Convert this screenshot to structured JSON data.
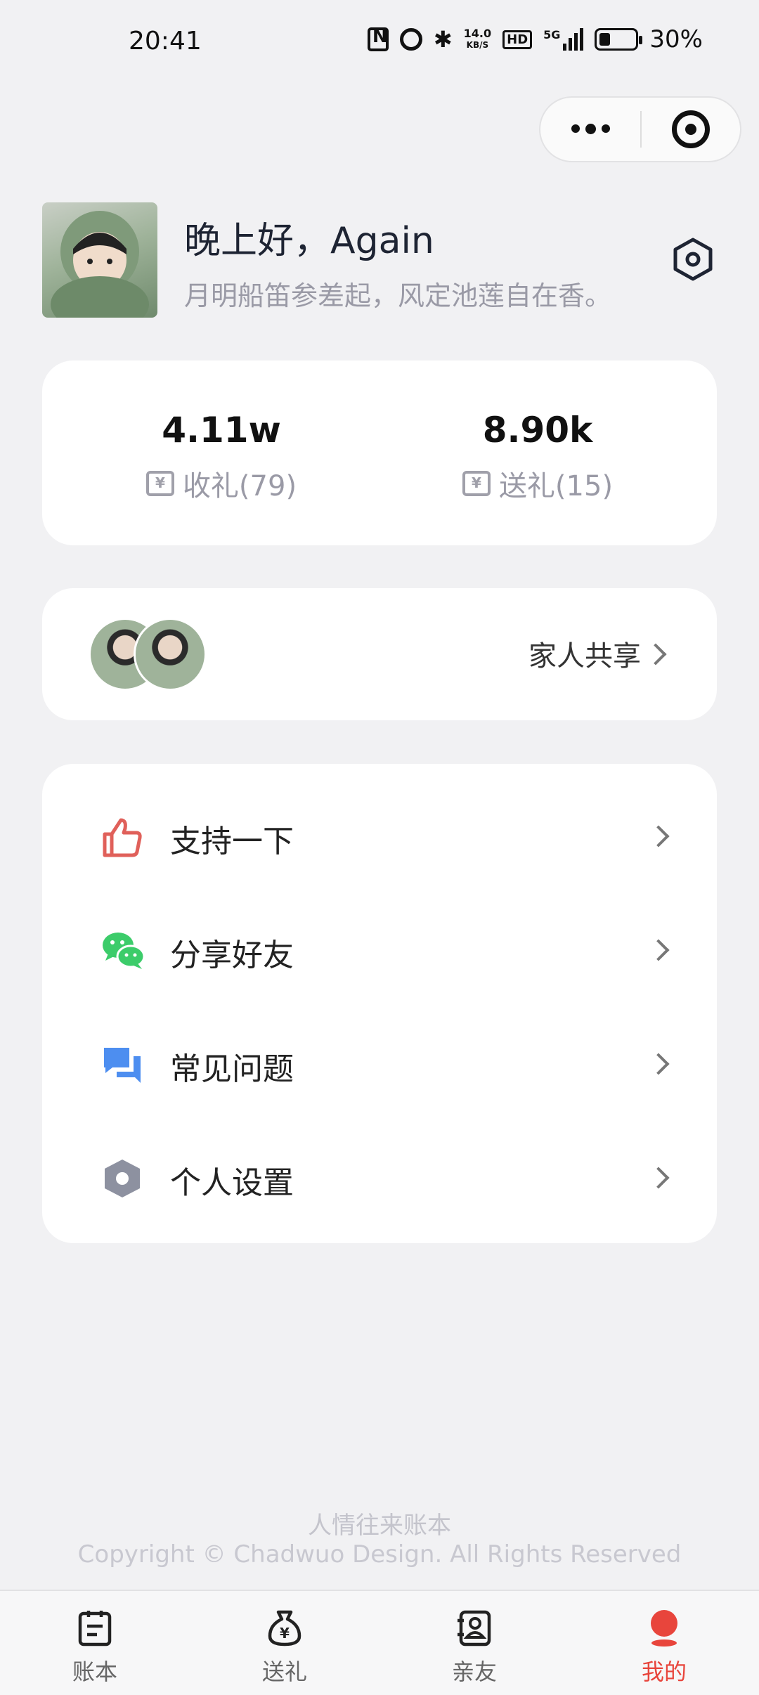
{
  "status_bar": {
    "time": "20:41",
    "net_speed_value": "14.0",
    "net_speed_unit": "KB/S",
    "hd": "HD",
    "network": "5G",
    "battery": "30%"
  },
  "profile": {
    "greeting": "晚上好，Again",
    "poem": "月明船笛参差起，风定池莲自在香。"
  },
  "stats": {
    "received_value": "4.11w",
    "received_label": "收礼(79)",
    "sent_value": "8.90k",
    "sent_label": "送礼(15)",
    "currency_glyph": "¥"
  },
  "family": {
    "label": "家人共享"
  },
  "menu": [
    {
      "label": "支持一下",
      "icon": "thumbs-up-icon",
      "color": "#e0605a"
    },
    {
      "label": "分享好友",
      "icon": "wechat-icon",
      "color": "#3ccc6a"
    },
    {
      "label": "常见问题",
      "icon": "chat-bubbles-icon",
      "color": "#4d8ef0"
    },
    {
      "label": "个人设置",
      "icon": "hexagon-nut-icon",
      "color": "#8d91a0"
    }
  ],
  "footer": {
    "app_name": "人情往来账本",
    "copyright": "Copyright © Chadwuo Design. All Rights Reserved"
  },
  "tabs": [
    {
      "label": "账本",
      "icon": "ledger-icon"
    },
    {
      "label": "送礼",
      "icon": "money-bag-icon"
    },
    {
      "label": "亲友",
      "icon": "contacts-icon"
    },
    {
      "label": "我的",
      "icon": "profile-icon",
      "active": true
    }
  ],
  "colors": {
    "accent": "#e8453c",
    "background": "#f1f1f3"
  }
}
